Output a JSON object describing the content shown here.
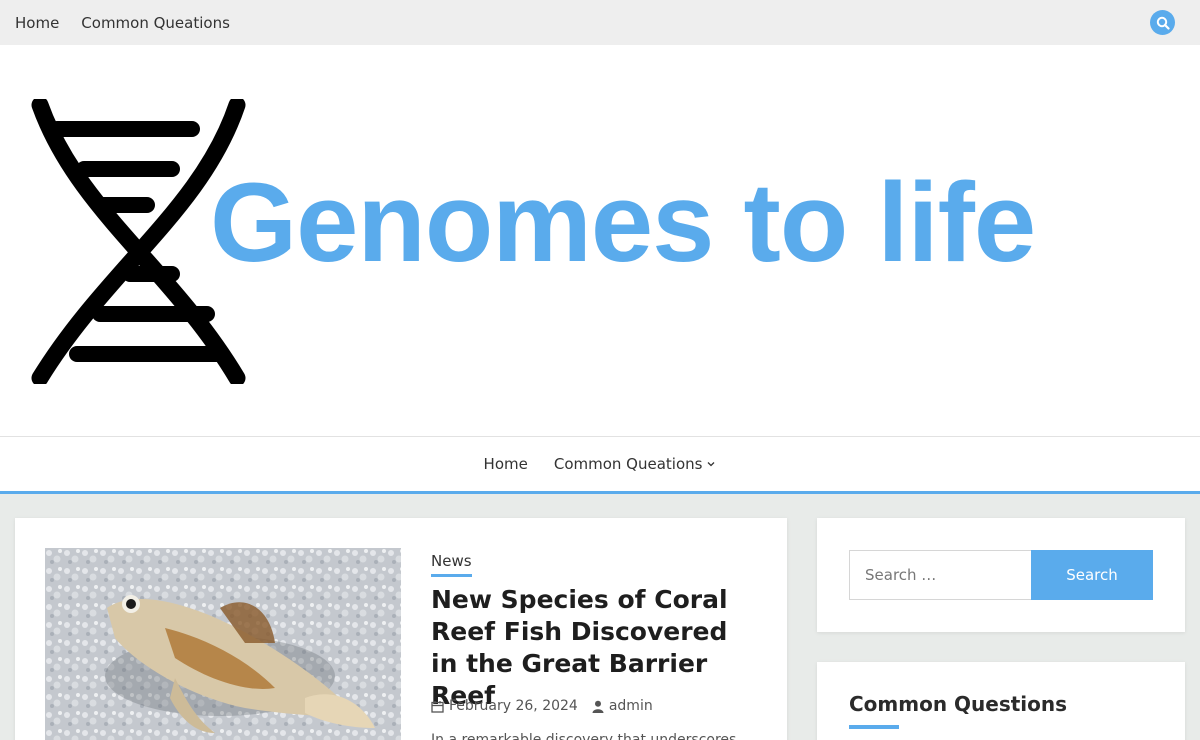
{
  "topbar": {
    "nav": [
      {
        "label": "Home"
      },
      {
        "label": "Common Queations"
      }
    ],
    "search_icon": "search-icon"
  },
  "brand": {
    "logo_icon": "dna-helix-icon",
    "title": "Genomes to life"
  },
  "main_nav": {
    "items": [
      {
        "label": "Home"
      },
      {
        "label": "Common Queations",
        "has_dropdown": true,
        "icon": "chevron-down-icon"
      }
    ]
  },
  "post": {
    "image_alt": "coral reef fish on sand",
    "category": "News",
    "title": "New Species of Coral Reef Fish Discovered in the Great Barrier Reef",
    "date": "February 26, 2024",
    "author": "admin",
    "excerpt": "In a remarkable discovery that underscores"
  },
  "sidebar": {
    "search": {
      "placeholder": "Search …",
      "button_label": "Search"
    },
    "common_questions": {
      "title": "Common Questions"
    }
  },
  "colors": {
    "accent": "#5aabec",
    "topbar_bg": "#eeeeee",
    "page_bg": "#e8ebe9"
  }
}
